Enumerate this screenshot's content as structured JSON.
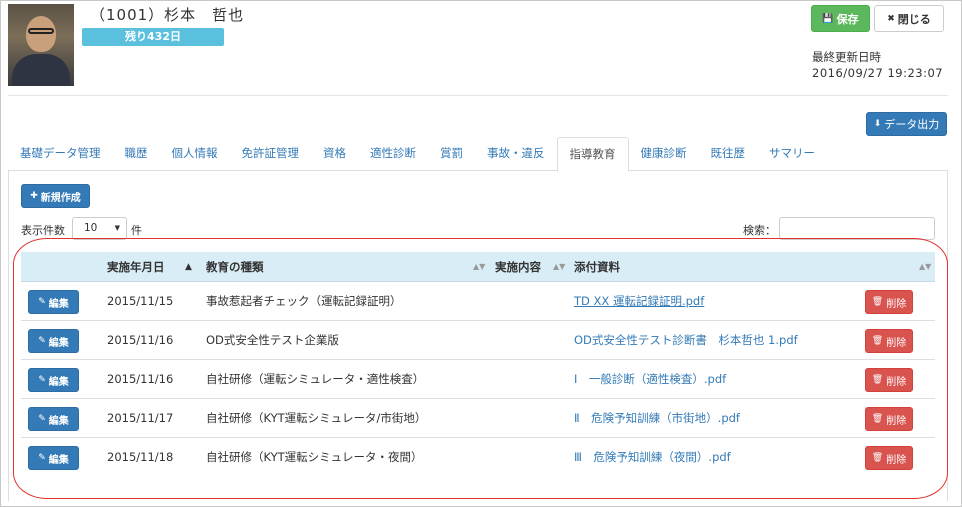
{
  "header": {
    "employee_name": "（1001）杉本　哲也",
    "remaining_badge": "残り432日",
    "save_label": "保存",
    "close_label": "閉じる",
    "last_updated_label": "最終更新日時",
    "last_updated_value": "2016/09/27 19:23:07",
    "export_label": "データ出力"
  },
  "tabs": [
    {
      "label": "基礎データ管理",
      "active": false
    },
    {
      "label": "職歴",
      "active": false
    },
    {
      "label": "個人情報",
      "active": false
    },
    {
      "label": "免許証管理",
      "active": false
    },
    {
      "label": "資格",
      "active": false
    },
    {
      "label": "適性診断",
      "active": false
    },
    {
      "label": "賞罰",
      "active": false
    },
    {
      "label": "事故・違反",
      "active": false
    },
    {
      "label": "指導教育",
      "active": true
    },
    {
      "label": "健康診断",
      "active": false
    },
    {
      "label": "既往歴",
      "active": false
    },
    {
      "label": "サマリー",
      "active": false
    }
  ],
  "toolbar": {
    "new_label": "新規作成",
    "page_length_label": "表示件数",
    "page_length_value": "10",
    "page_length_unit": "件",
    "search_label": "検索："
  },
  "table": {
    "columns": [
      "実施年月日",
      "教育の種類",
      "実施内容",
      "添付資料"
    ],
    "edit_label": "編集",
    "delete_label": "削除",
    "rows": [
      {
        "date": "2015/11/15",
        "type": "事故惹起者チェック（運転記録証明）",
        "content": "",
        "attachment": "TD XX 運転記録証明.pdf"
      },
      {
        "date": "2015/11/16",
        "type": "OD式安全性テスト企業版",
        "content": "",
        "attachment": "OD式安全性テスト診断書　杉本哲也 1.pdf"
      },
      {
        "date": "2015/11/16",
        "type": "自社研修（運転シミュレータ・適性検査）",
        "content": "",
        "attachment": "Ⅰ　一般診断（適性検査）.pdf"
      },
      {
        "date": "2015/11/17",
        "type": "自社研修（KYT運転シミュレータ/市街地）",
        "content": "",
        "attachment": "Ⅱ　危険予知訓練（市街地）.pdf"
      },
      {
        "date": "2015/11/18",
        "type": "自社研修（KYT運転シミュレータ・夜間）",
        "content": "",
        "attachment": "Ⅲ　危険予知訓練（夜間）.pdf"
      }
    ]
  },
  "colors": {
    "primary": "#337ab7",
    "success": "#5cb85c",
    "danger": "#d9534f",
    "info": "#5bc0de",
    "table_header": "#d9edf7",
    "highlight_outline": "#e0322e"
  }
}
